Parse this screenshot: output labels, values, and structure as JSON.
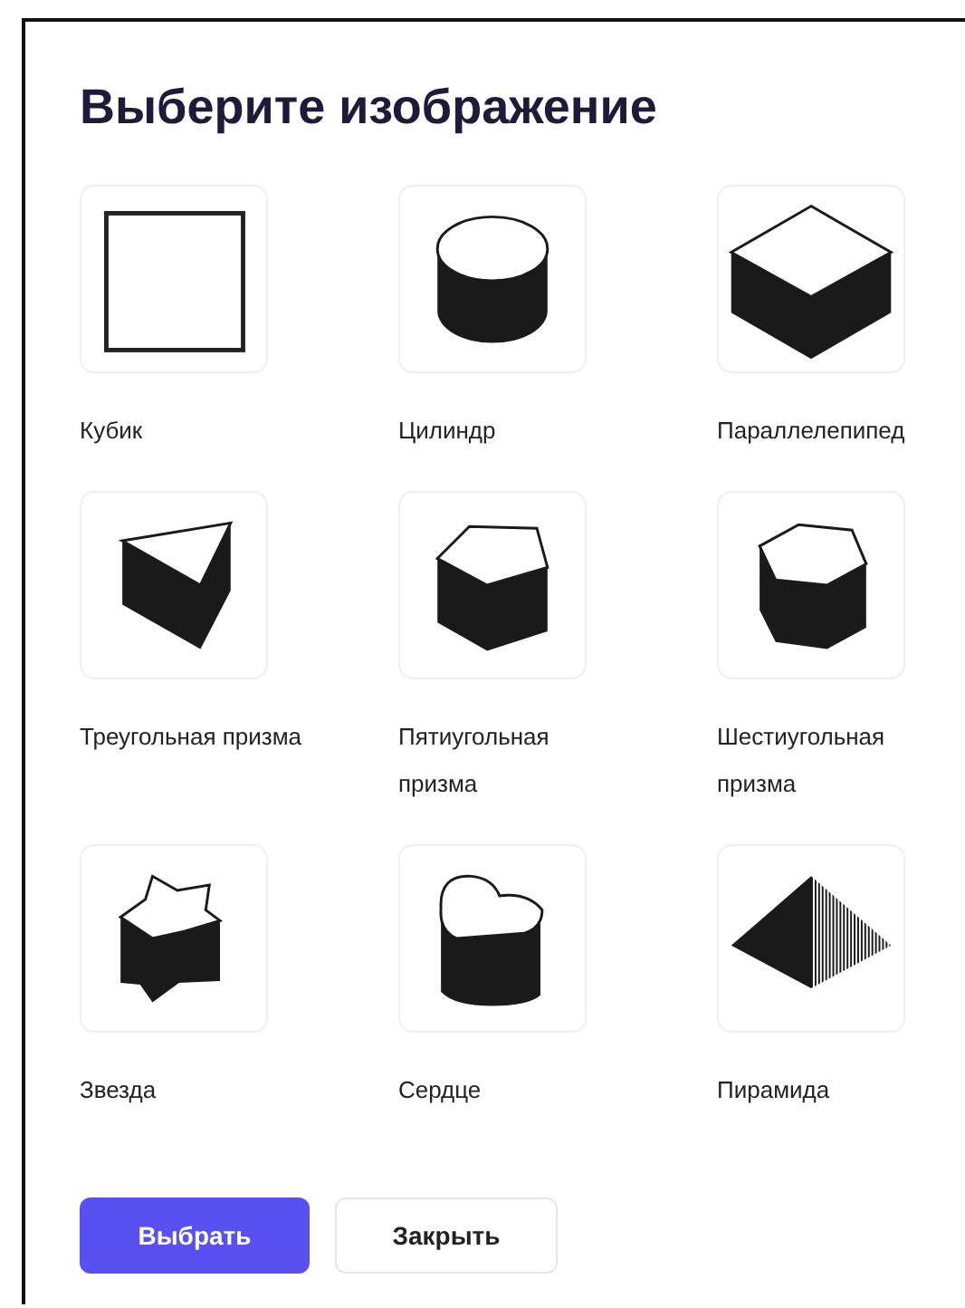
{
  "dialog": {
    "title": "Выберите изображение",
    "items": [
      {
        "kind": "cube",
        "label": "Кубик"
      },
      {
        "kind": "cylinder",
        "label": "Цилиндр"
      },
      {
        "kind": "box",
        "label": "Параллелепипед"
      },
      {
        "kind": "triangular",
        "label": "Треугольная призма"
      },
      {
        "kind": "pentagonal",
        "label": "Пятиугольная призма"
      },
      {
        "kind": "hexagonal",
        "label": "Шестиугольная призма"
      },
      {
        "kind": "star",
        "label": "Звезда"
      },
      {
        "kind": "heart",
        "label": "Сердце"
      },
      {
        "kind": "pyramid",
        "label": "Пирамида"
      }
    ],
    "buttons": [
      {
        "kind": "primary",
        "label": "Выбрать"
      },
      {
        "kind": "secondary",
        "label": "Закрыть"
      }
    ]
  }
}
